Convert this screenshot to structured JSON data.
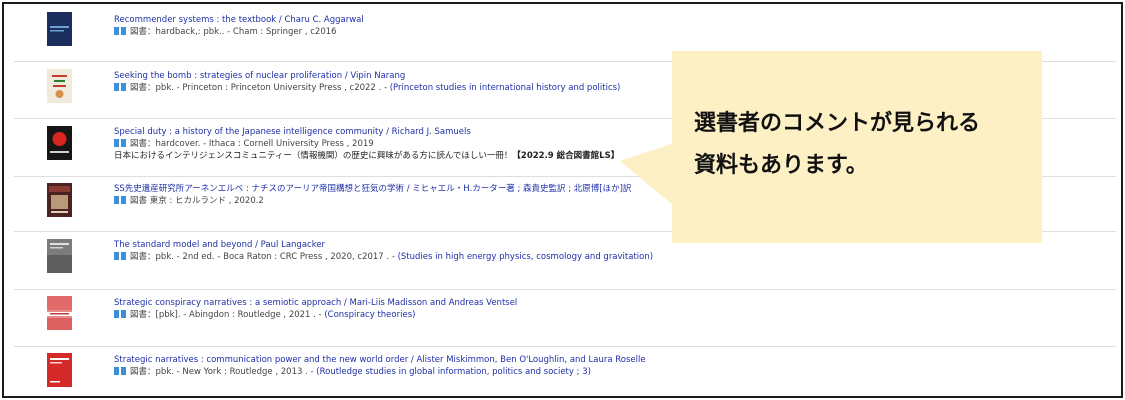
{
  "results": [
    {
      "title": "Recommender systems : the textbook / Charu C. Aggarwal",
      "type": "図書",
      "details": "hardback,: pbk.. - Cham : Springer , c2016",
      "series": "",
      "comment": "",
      "comment_source": "",
      "cover_color": "#1b2d5a"
    },
    {
      "title": "Seeking the bomb : strategies of nuclear proliferation / Vipin Narang",
      "type": "図書",
      "details": "pbk. - Princeton : Princeton University Press , c2022 . - ",
      "series": "(Princeton studies in international history and politics)",
      "comment": "",
      "comment_source": "",
      "cover_color": "#e9e4d6"
    },
    {
      "title": "Special duty : a history of the Japanese intelligence community / Richard J. Samuels",
      "type": "図書",
      "details": "hardcover. - Ithaca : Cornell University Press , 2019",
      "series": "",
      "comment": "日本におけるインテリジェンスコミュニティー（情報機関）の歴史に興味がある方に読んでほしい一冊！",
      "comment_source": "【2022.9 総合図書館LS】",
      "cover_color": "#1a1a1a"
    },
    {
      "title": "SS先史遺産研究所アーネンエルベ : ナチスのアーリア帝国構想と狂気の学術 / ミヒャエル・H.カーター著 ; 森貴史監訳 ; 北原博[ほか]訳",
      "type": "図書",
      "details": "東京 : ヒカルランド , 2020.2",
      "series": "",
      "comment": "",
      "comment_source": "",
      "cover_color": "#5a2a2a"
    },
    {
      "title": "The standard model and beyond / Paul Langacker",
      "type": "図書",
      "details": "pbk. - 2nd ed. - Boca Raton : CRC Press , 2020, c2017 . - ",
      "series": "(Studies in high energy physics, cosmology and gravitation)",
      "comment": "",
      "comment_source": "",
      "cover_color": "#8a8a8a"
    },
    {
      "title": "Strategic conspiracy narratives : a semiotic approach / Mari-Liis Madisson and Andreas Ventsel",
      "type": "図書",
      "details": "[pbk]. - Abingdon : Routledge , 2021 . - ",
      "series": "(Conspiracy theories)",
      "comment": "",
      "comment_source": "",
      "cover_color": "#e07a7a"
    },
    {
      "title": "Strategic narratives : communication power and the new world order / Alister Miskimmon, Ben O'Loughlin, and Laura Roselle",
      "type": "図書",
      "details": "pbk. - New York : Routledge , 2013 . - ",
      "series": "(Routledge studies in global information, politics and society ; 3)",
      "comment": "",
      "comment_source": "",
      "cover_color": "#d42a2a"
    }
  ],
  "callout": {
    "line1": "選書者のコメントが見られる",
    "line2": "資料もあります。"
  }
}
